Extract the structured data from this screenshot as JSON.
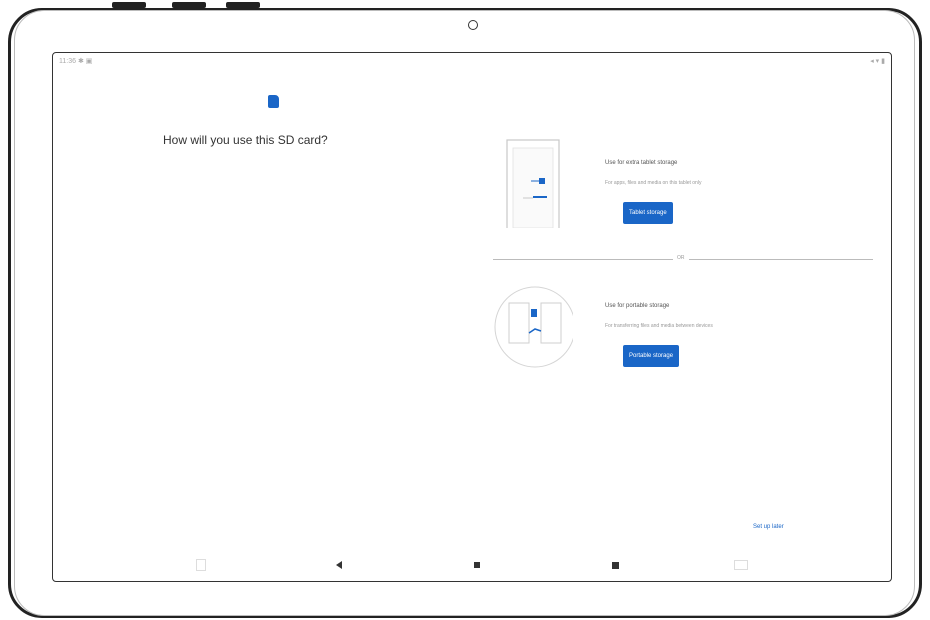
{
  "status_bar": {
    "time_icons": "11:36 ✱ ▣",
    "right_icons": "◂ ▾ ▮"
  },
  "setup": {
    "question": "How will you use this SD card?"
  },
  "options": [
    {
      "title": "Use for extra tablet storage",
      "description": "For apps, files and media on this tablet only",
      "button_label": "Tablet storage"
    },
    {
      "title": "Use for portable storage",
      "description": "For transferring files and media between devices",
      "button_label": "Portable storage"
    }
  ],
  "divider_label": "OR",
  "skip_label": "Set up later",
  "icons": {
    "sd_card": "sd-card-icon",
    "nav_recents": "recents-icon",
    "nav_back": "back-icon",
    "nav_home": "home-icon",
    "nav_square": "overview-icon",
    "nav_extra": "keyboard-icon"
  },
  "colors": {
    "accent": "#1a66c7",
    "text": "#333333",
    "muted": "#999999"
  }
}
